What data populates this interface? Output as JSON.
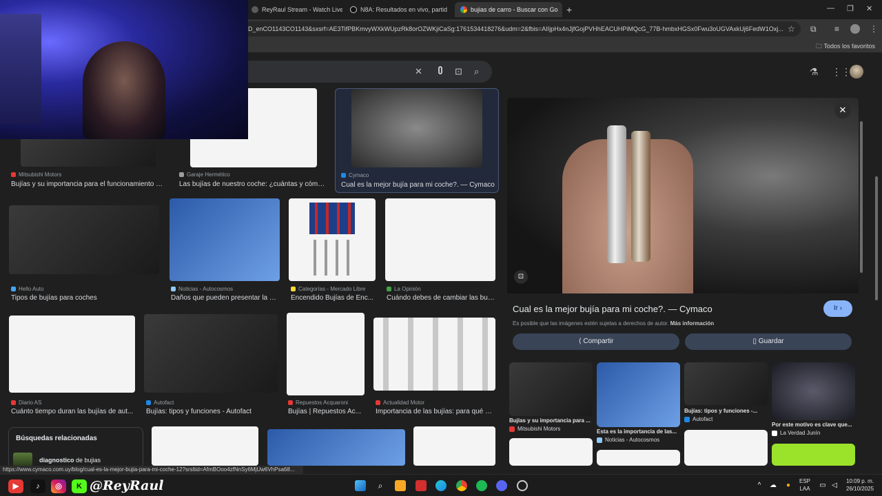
{
  "browser": {
    "tabs": [
      {
        "title": "ReyRaul Stream - Watch Live o",
        "active": false
      },
      {
        "title": "N8A: Resultados en vivo, partid",
        "active": false
      },
      {
        "title": "bujias de carro - Buscar con Go",
        "active": true
      }
    ],
    "url": "D_enCO1143CO1143&sxsrf=AE3TifPBKmvyWXkWUpzRk8orOZWKjiCaSg:1761534418276&udm=2&fbis=AIIjpHx4nJjfGojPVHhEACUHPiMQcG_77B-hmbxHGSx0Fwu3oUGVAxkUj6FedW1Oxj...",
    "bookmarks_all": "Todos los favoritos"
  },
  "results": [
    {
      "source": "Mitsubishi Motors",
      "title": "Bujías y su importancia para el funcionamiento ópt...",
      "fav": "#e53935"
    },
    {
      "source": "Garaje Hermético",
      "title": "Las bujías de nuestro coche: ¿cuántas y cómo?...",
      "fav": "#9e9e9e"
    },
    {
      "source": "Cymaco",
      "title": "Cual es la mejor bujía para mi coche?. — Cymaco",
      "fav": "#1e88e5"
    },
    {
      "source": "Hello Auto",
      "title": "Tipos de bujías para coches",
      "fav": "#42a5f5"
    },
    {
      "source": "Noticias - Autocosmos",
      "title": "Daños que pueden presentar la b...",
      "fav": "#90caf9"
    },
    {
      "source": "Categorías - Mercado Libre",
      "title": "Encendido Bujías de Enc...",
      "fav": "#fdd835"
    },
    {
      "source": "La Opinión",
      "title": "Cuándo debes de cambiar las bují...",
      "fav": "#43a047"
    },
    {
      "source": "Diario AS",
      "title": "Cuánto tiempo duran las bujías de aut...",
      "fav": "#e53935"
    },
    {
      "source": "Autofact",
      "title": "Bujías: tipos y funciones - Autofact",
      "fav": "#1e88e5"
    },
    {
      "source": "Repuestos Acquaroni",
      "title": "Bujías | Repuestos Ac...",
      "fav": "#e53935"
    },
    {
      "source": "Actualidad Motor",
      "title": "Importancia de las bujías: para qué si...",
      "fav": "#e53935"
    }
  ],
  "related_searches": {
    "heading": "Búsquedas relacionadas",
    "item_bold": "diagnostico",
    "item_rest": " de bujias"
  },
  "panel": {
    "title": "Cual es la mejor bujía para mi coche?. — Cymaco",
    "visit_label": "Ir",
    "copyright": "Es posible que las imágenes estén sujetas a derechos de autor.",
    "more_info": "Más información",
    "share_label": "Compartir",
    "save_label": "Guardar",
    "related": [
      {
        "title": "Bujías y su importancia para ...",
        "source": "Mitsubishi Motors",
        "fav": "#e53935"
      },
      {
        "title": "Esta es la importancia de las...",
        "source": "Noticias - Autocosmos",
        "fav": "#90caf9"
      },
      {
        "title": "Bujías: tipos y funciones -...",
        "source": "Autofact",
        "fav": "#1e88e5"
      },
      {
        "title": "Por este motivo es clave que...",
        "source": "La Verdad Junín",
        "fav": "#ffffff"
      }
    ]
  },
  "status_url": "https://www.cymaco.com.uy/blog/cual-es-la-mejor-bujia-para-mi-coche-12?srsltid=AfmBOoo4zfNnSy6MjUw6VhPsa68...",
  "stream": {
    "handle": "@ReyRaul"
  },
  "taskbar": {
    "lang_top": "ESP",
    "lang_bottom": "LAA",
    "time": "10:09 p. m.",
    "date": "26/10/2025"
  }
}
